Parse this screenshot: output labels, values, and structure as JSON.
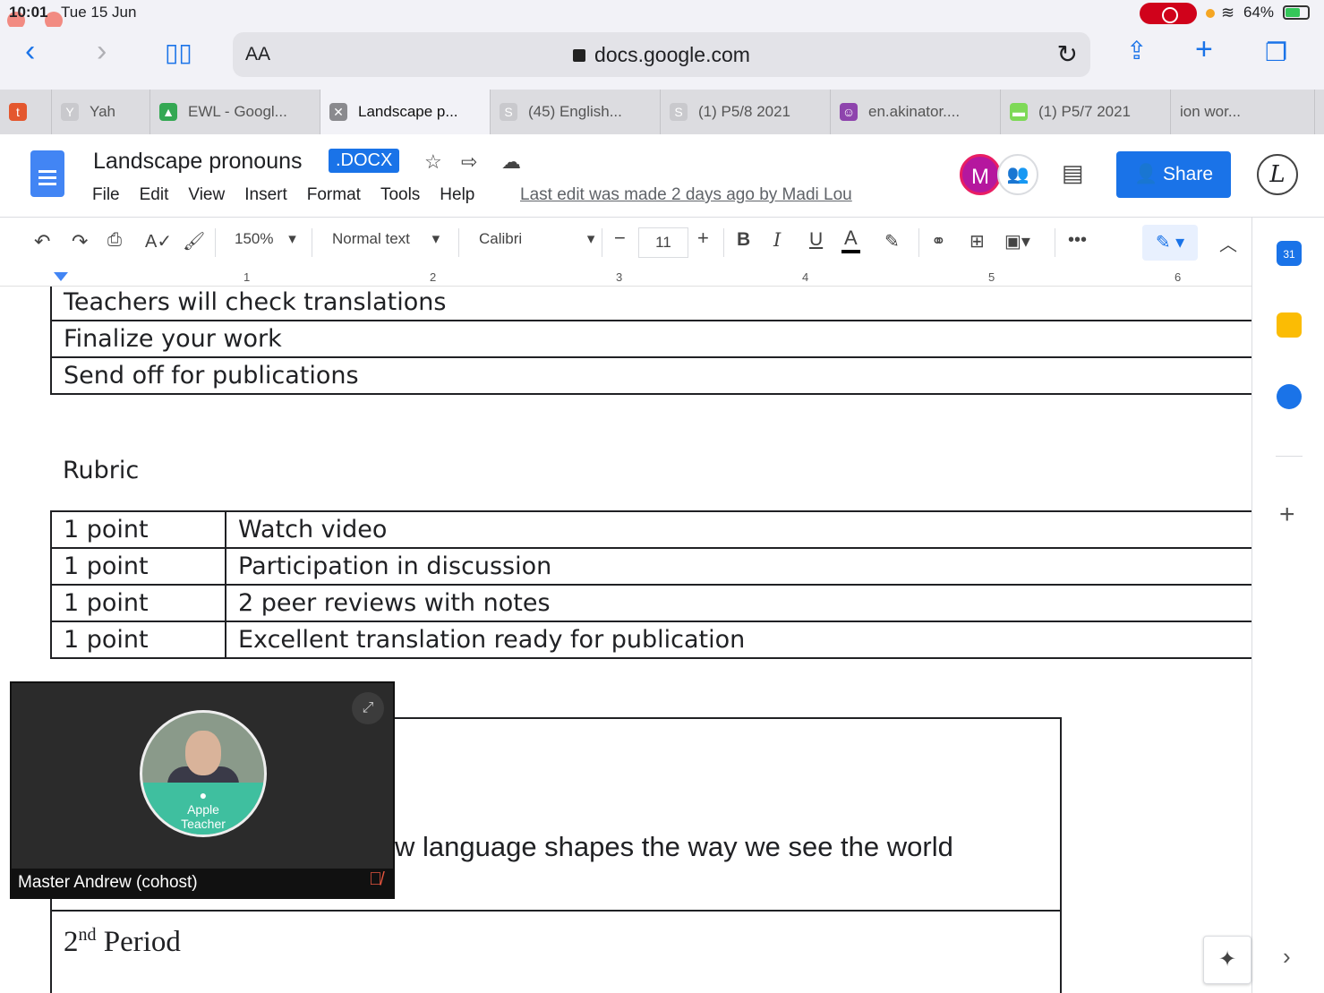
{
  "status_bar": {
    "time": "10:01",
    "date": "Tue 15 Jun",
    "battery": "64%"
  },
  "browser": {
    "text_size_label": "AA",
    "url": "docs.google.com",
    "tabs": [
      {
        "label": "",
        "fav": "t",
        "fav_color": "#e4572e"
      },
      {
        "label": "Yah",
        "fav": "Y",
        "fav_color": "#c9c9cd"
      },
      {
        "label": "EWL - Googl...",
        "fav": "▲",
        "fav_color": "#34a853"
      },
      {
        "label": "Landscape p...",
        "fav": "✕",
        "fav_color": "#8a8a8e"
      },
      {
        "label": "(45) English...",
        "fav": "S",
        "fav_color": "#c9c9cd"
      },
      {
        "label": "(1) P5/8 2021",
        "fav": "S",
        "fav_color": "#c9c9cd"
      },
      {
        "label": "en.akinator....",
        "fav": "☺",
        "fav_color": "#8e44ad"
      },
      {
        "label": "(1) P5/7 2021",
        "fav": "▬",
        "fav_color": "#7ed957"
      },
      {
        "label": "ion wor...",
        "fav": "",
        "fav_color": ""
      }
    ]
  },
  "docs": {
    "title": "Landscape pronouns",
    "format_badge": ".DOCX",
    "menus": [
      "File",
      "Edit",
      "View",
      "Insert",
      "Format",
      "Tools",
      "Help"
    ],
    "last_edit": "Last edit was made 2 days ago by Madi Lou",
    "avatar_initial": "M",
    "share_label": "Share",
    "account_initial": "L"
  },
  "toolbar": {
    "zoom": "150%",
    "style": "Normal text",
    "font": "Calibri",
    "font_size": "11",
    "bold": "B",
    "italic": "I",
    "underline": "U",
    "text_color": "A"
  },
  "ruler": [
    "1",
    "2",
    "3",
    "4",
    "5",
    "6"
  ],
  "document": {
    "steps_table": [
      "Teachers will check translations",
      "Finalize your work",
      "Send off for publications"
    ],
    "rubric_heading": "Rubric",
    "rubric_table": [
      {
        "points": "1 point",
        "task": "Watch video"
      },
      {
        "points": "1 point",
        "task": "Participation in discussion"
      },
      {
        "points": "1 point",
        "task": "2 peer reviews with notes"
      },
      {
        "points": "1 point",
        "task": "Excellent translation ready for publication"
      }
    ],
    "quote_fragment": "w language shapes the way we see the world",
    "period_num": "2",
    "period_sup": "nd",
    "period_word": "Period"
  },
  "video": {
    "participant": "Master Andrew (cohost)",
    "badge_line1": "Apple",
    "badge_line2": "Teacher"
  },
  "side_panel": {
    "calendar_day": "31"
  }
}
